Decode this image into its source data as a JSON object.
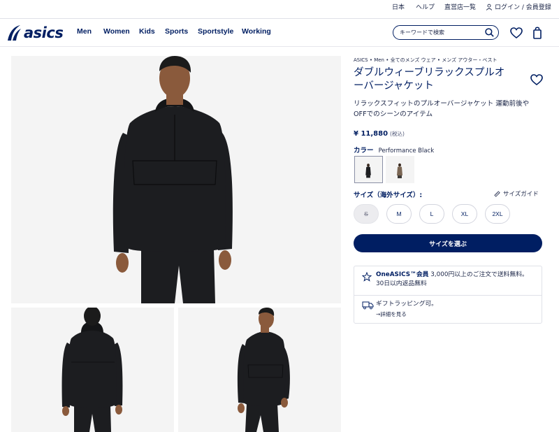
{
  "utility_bar": {
    "country": "日本",
    "help": "ヘルプ",
    "stores": "直営店一覧",
    "login": "ログイン / 会員登録"
  },
  "header": {
    "logo_text": "asics",
    "nav": [
      "Men",
      "Women",
      "Kids",
      "Sports",
      "Sportstyle",
      "Working"
    ],
    "search_placeholder": "キーワードで検索",
    "icons": [
      "search-icon",
      "heart-icon",
      "bag-icon"
    ]
  },
  "product": {
    "breadcrumb": "ASICS • Men • 全てのメンズ ウェア • メンズ アウター・ベスト",
    "title_line1": "ダブルウィーブリラックスプルオ",
    "title_line2": "ーバージャケット",
    "description_line1": "リラックスフィットのプルオーバージャケット 運動前後や",
    "description_line2": "OFFでのシーンのアイテム",
    "price": "¥ 11,880",
    "tax_note": "(税込)",
    "color_label": "カラー",
    "color_value": "Performance Black",
    "size_label": "サイズ（海外サイズ）:",
    "size_guide": "サイズガイド",
    "sizes": [
      {
        "label": "S",
        "available": false
      },
      {
        "label": "M",
        "available": true
      },
      {
        "label": "L",
        "available": true
      },
      {
        "label": "XL",
        "available": true
      },
      {
        "label": "2XL",
        "available": true
      }
    ],
    "cta": "サイズを選ぶ"
  },
  "promo": {
    "member_brand": "OneASICS™会員",
    "member_text": " 3,000円以上のご注文で送料無料。",
    "member_line2": "30日以内返品無料",
    "gift_text": "ギフトラッピング可。",
    "gift_link": "→詳細を見る"
  },
  "colors": {
    "brand_navy": "#001e62",
    "image_bg": "#f4f4f4",
    "jacket_black": "#1c1d20",
    "jacket_brown": "#7a6654"
  }
}
